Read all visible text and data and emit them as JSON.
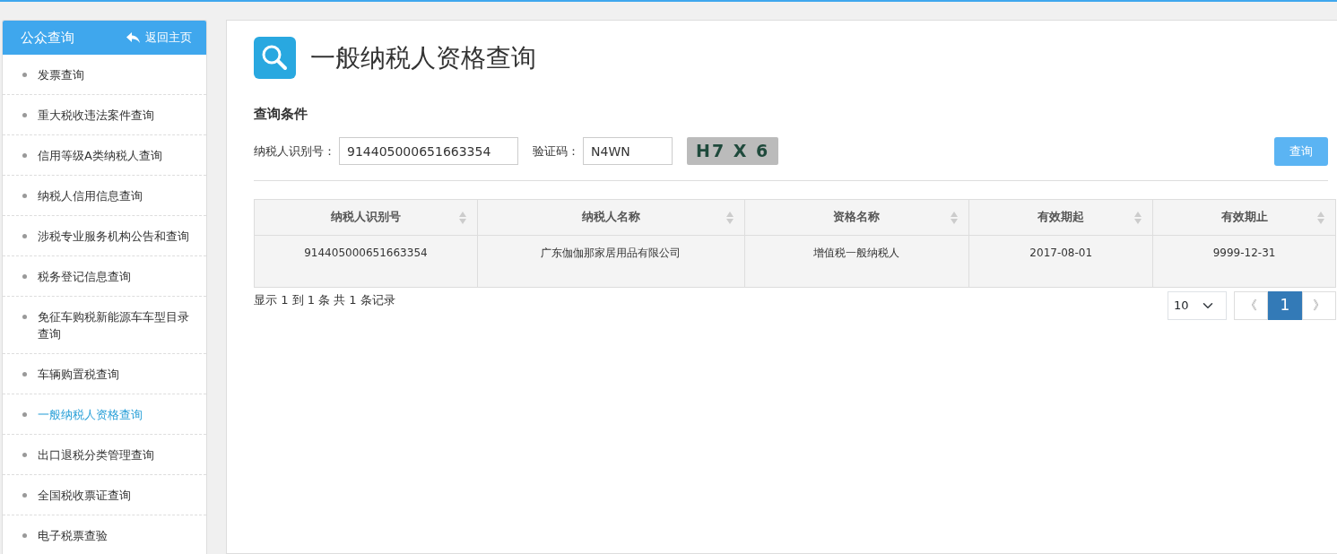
{
  "sidebar": {
    "title": "公众查询",
    "back_link": "返回主页",
    "items": [
      {
        "label": "发票查询",
        "selected": false
      },
      {
        "label": "重大税收违法案件查询",
        "selected": false
      },
      {
        "label": "信用等级A类纳税人查询",
        "selected": false
      },
      {
        "label": "纳税人信用信息查询",
        "selected": false
      },
      {
        "label": "涉税专业服务机构公告和查询",
        "selected": false
      },
      {
        "label": "税务登记信息查询",
        "selected": false
      },
      {
        "label": "免征车购税新能源车车型目录查询",
        "selected": false
      },
      {
        "label": "车辆购置税查询",
        "selected": false
      },
      {
        "label": "一般纳税人资格查询",
        "selected": true
      },
      {
        "label": "出口退税分类管理查询",
        "selected": false
      },
      {
        "label": "全国税收票证查询",
        "selected": false
      },
      {
        "label": "电子税票查验",
        "selected": false
      }
    ]
  },
  "page_title": "一般纳税人资格查询",
  "form": {
    "section_title": "查询条件",
    "taxpayer_id_label": "纳税人识别号：",
    "taxpayer_id_value": "914405000651663354",
    "captcha_label": "验证码：",
    "captcha_value": "N4WN",
    "captcha_image_text": "H7 X 6",
    "submit": "查询"
  },
  "table": {
    "columns": [
      "纳税人识别号",
      "纳税人名称",
      "资格名称",
      "有效期起",
      "有效期止"
    ],
    "rows": [
      [
        "914405000651663354",
        "广东伽伽那家居用品有限公司",
        "增值税一般纳税人",
        "2017-08-01",
        "9999-12-31"
      ]
    ]
  },
  "summary": "显示 1 到 1 条 共 1 条记录",
  "page_size": "10",
  "pagination": {
    "prev": "《",
    "pages": [
      {
        "label": "1",
        "selected": true
      }
    ],
    "next": "》"
  }
}
